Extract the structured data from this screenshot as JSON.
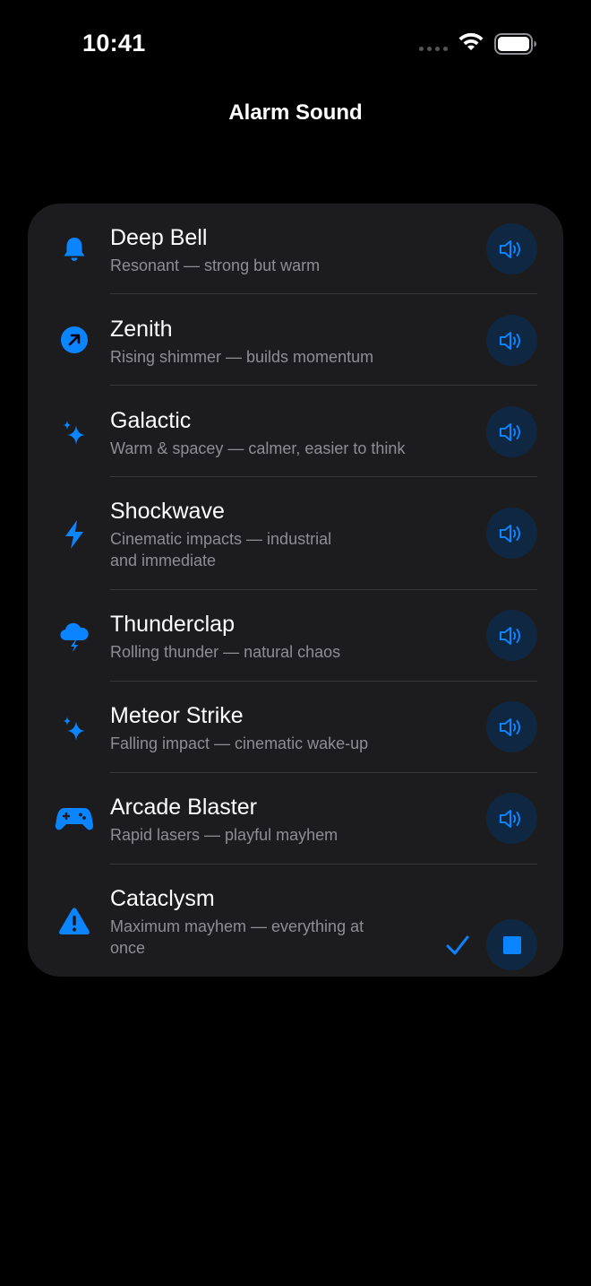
{
  "status": {
    "time": "10:41"
  },
  "nav": {
    "title": "Alarm Sound"
  },
  "colors": {
    "accent": "#0a84ff",
    "background": "#000000",
    "card": "#1c1c1e",
    "secondary_text": "#8e8e93"
  },
  "sounds": [
    {
      "title": "Deep Bell",
      "subtitle": "Resonant — strong but warm",
      "icon": "bell-icon",
      "selected": false
    },
    {
      "title": "Zenith",
      "subtitle": "Rising shimmer — builds momentum",
      "icon": "arrow-up-right-circle-icon",
      "selected": false
    },
    {
      "title": "Galactic",
      "subtitle": "Warm & spacey — calmer, easier to think",
      "icon": "sparkles-icon",
      "selected": false
    },
    {
      "title": "Shockwave",
      "subtitle": "Cinematic impacts — industrial and immediate",
      "icon": "bolt-icon",
      "selected": false
    },
    {
      "title": "Thunderclap",
      "subtitle": "Rolling thunder — natural chaos",
      "icon": "cloud-bolt-icon",
      "selected": false
    },
    {
      "title": "Meteor Strike",
      "subtitle": "Falling impact — cinematic wake-up",
      "icon": "sparkles-icon",
      "selected": false
    },
    {
      "title": "Arcade Blaster",
      "subtitle": "Rapid lasers — playful mayhem",
      "icon": "gamecontroller-icon",
      "selected": false
    },
    {
      "title": "Cataclysm",
      "subtitle": "Maximum mayhem — everything at once",
      "icon": "warning-triangle-icon",
      "selected": true
    }
  ]
}
